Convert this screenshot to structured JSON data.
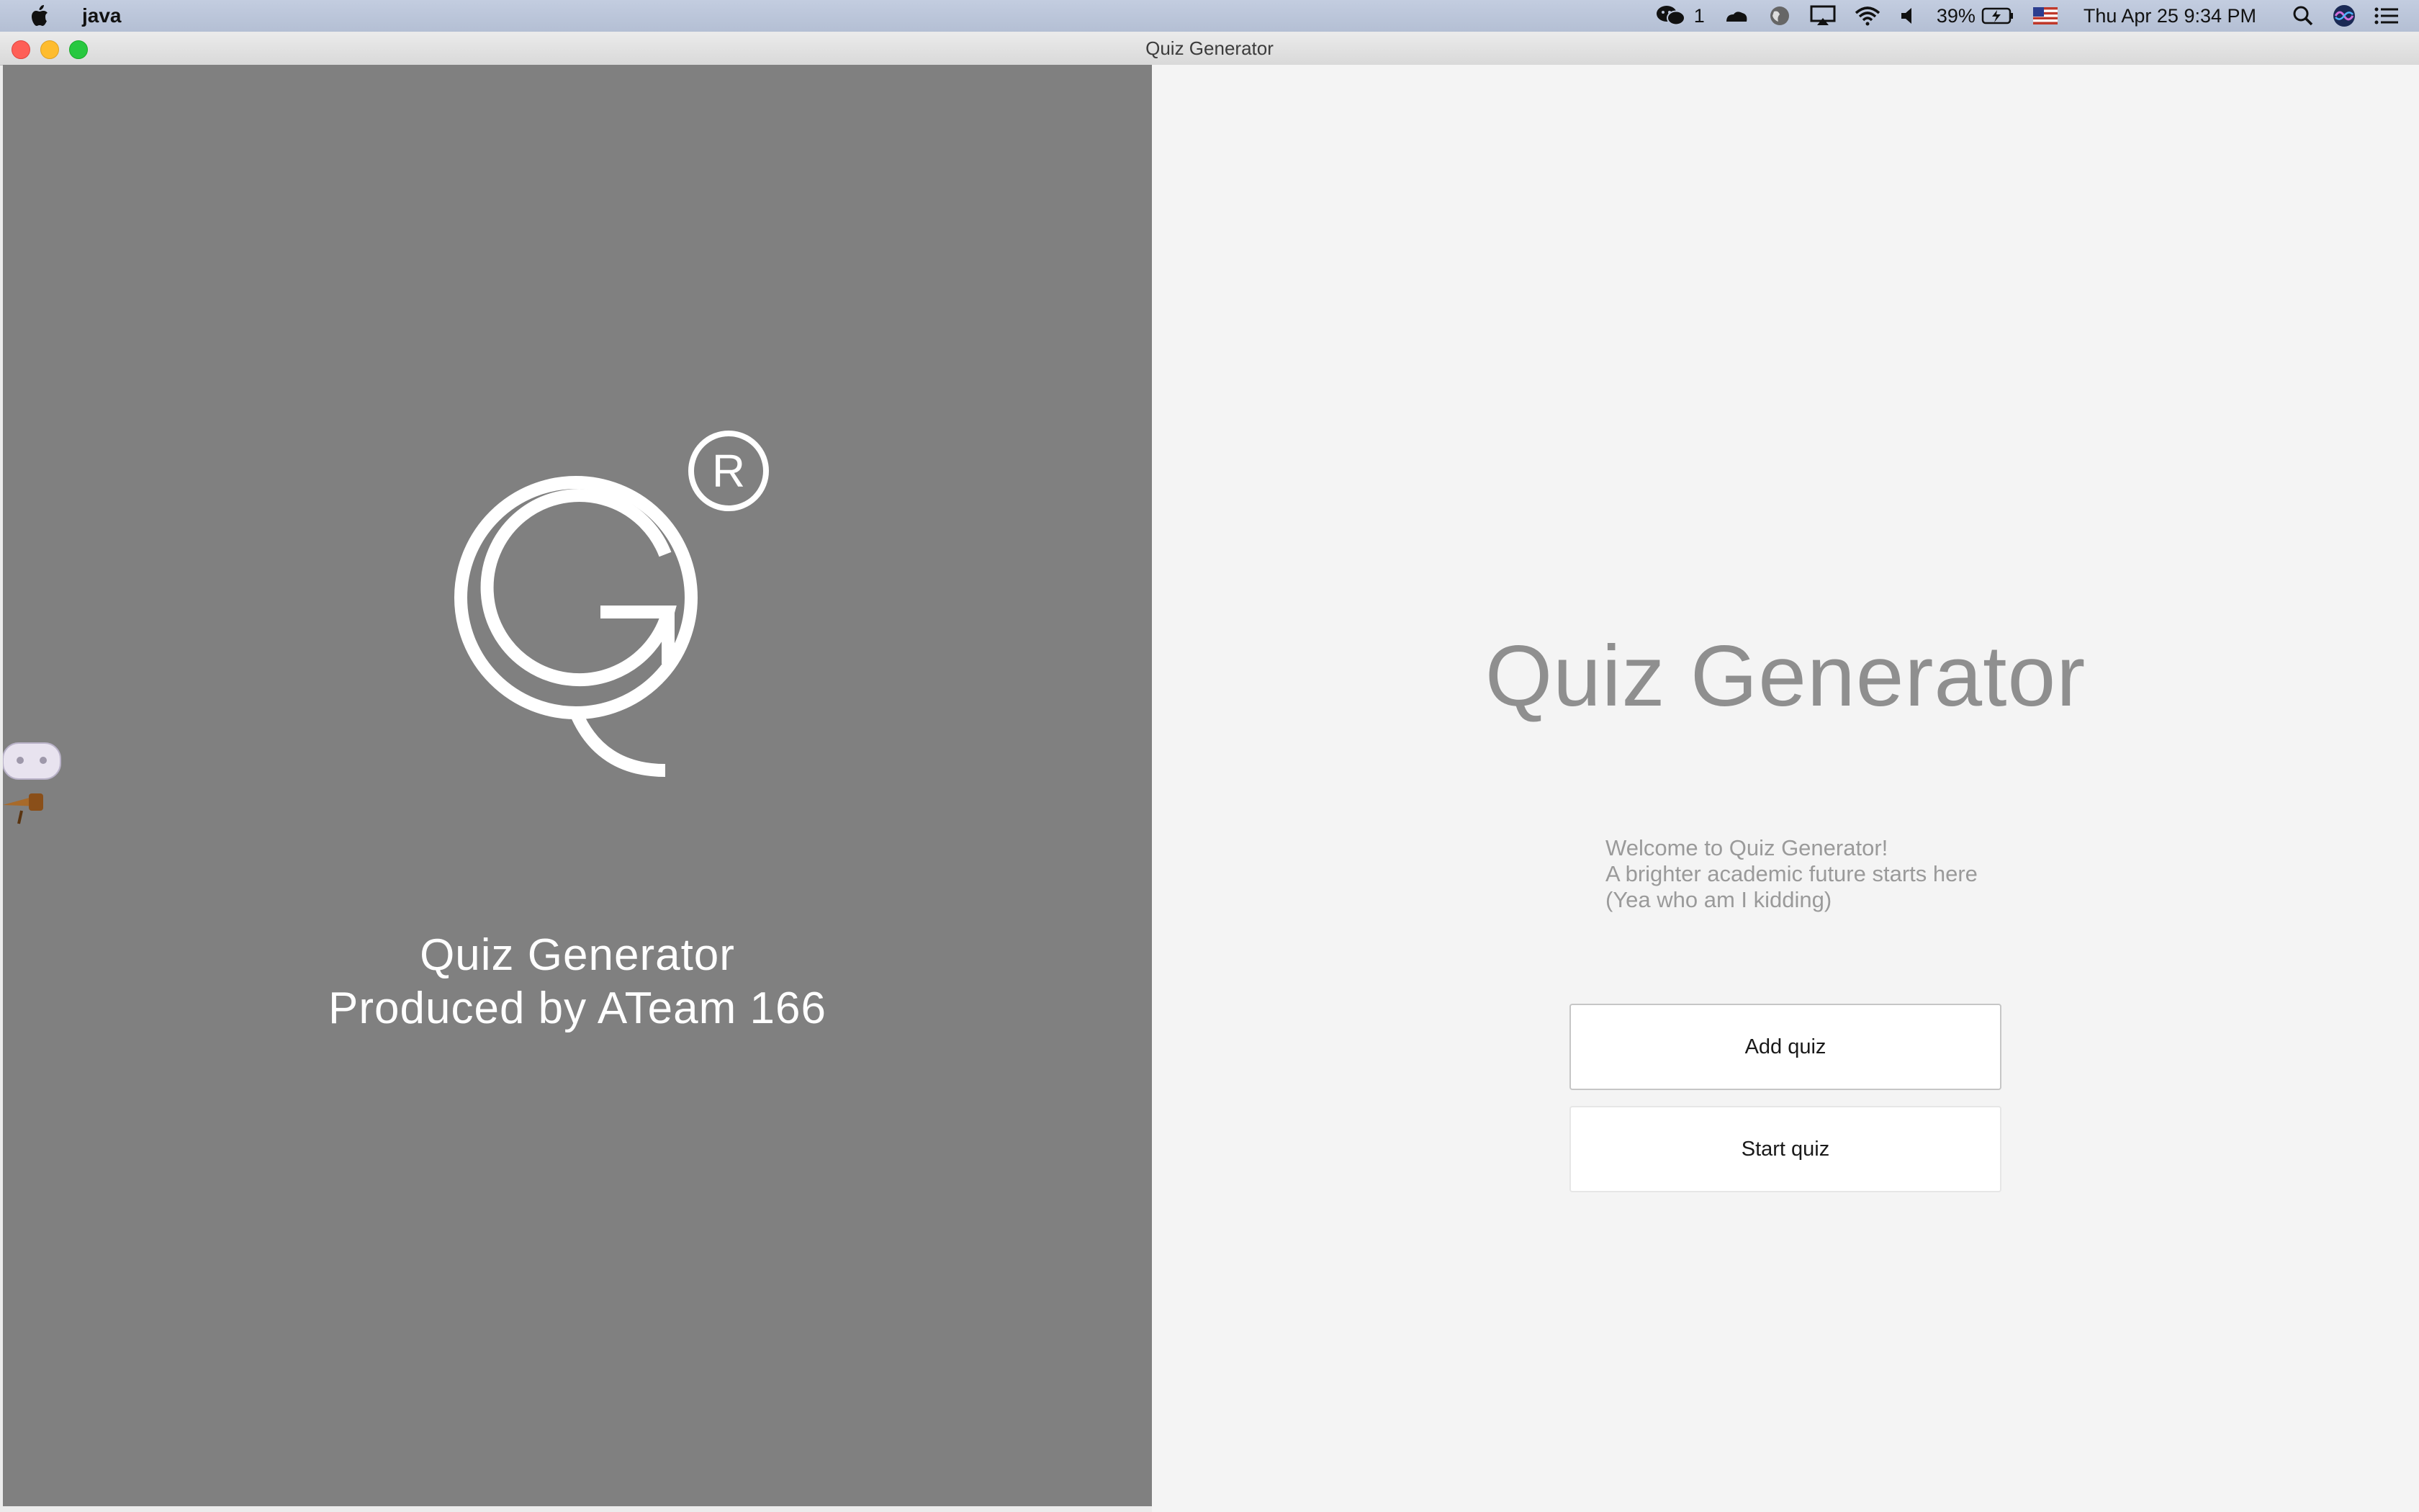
{
  "menubar": {
    "app_name": "java",
    "wechat_count": "1",
    "battery": "39%",
    "datetime": "Thu Apr 25  9:34 PM"
  },
  "window": {
    "title": "Quiz Generator"
  },
  "left_panel": {
    "logo_letter": "G",
    "registered_mark": "R",
    "caption_line1": "Quiz Generator",
    "caption_line2": "Produced by ATeam 166"
  },
  "right_panel": {
    "title": "Quiz Generator",
    "welcome_lines": [
      "Welcome to Quiz Generator!",
      "A brighter academic future starts here",
      "(Yea who am I kidding)"
    ],
    "add_button": "Add quiz",
    "start_button": "Start quiz"
  },
  "colors": {
    "left_bg": "#808080",
    "right_bg": "#f4f4f4",
    "title_gray": "#8f8f8f"
  },
  "icons": [
    "apple-icon",
    "wechat-icon",
    "cloud-icon",
    "globe-icon",
    "airplay-icon",
    "wifi-icon",
    "volume-icon",
    "battery-icon",
    "flag-icon",
    "spotlight-icon",
    "siri-icon",
    "notification-center-icon"
  ]
}
